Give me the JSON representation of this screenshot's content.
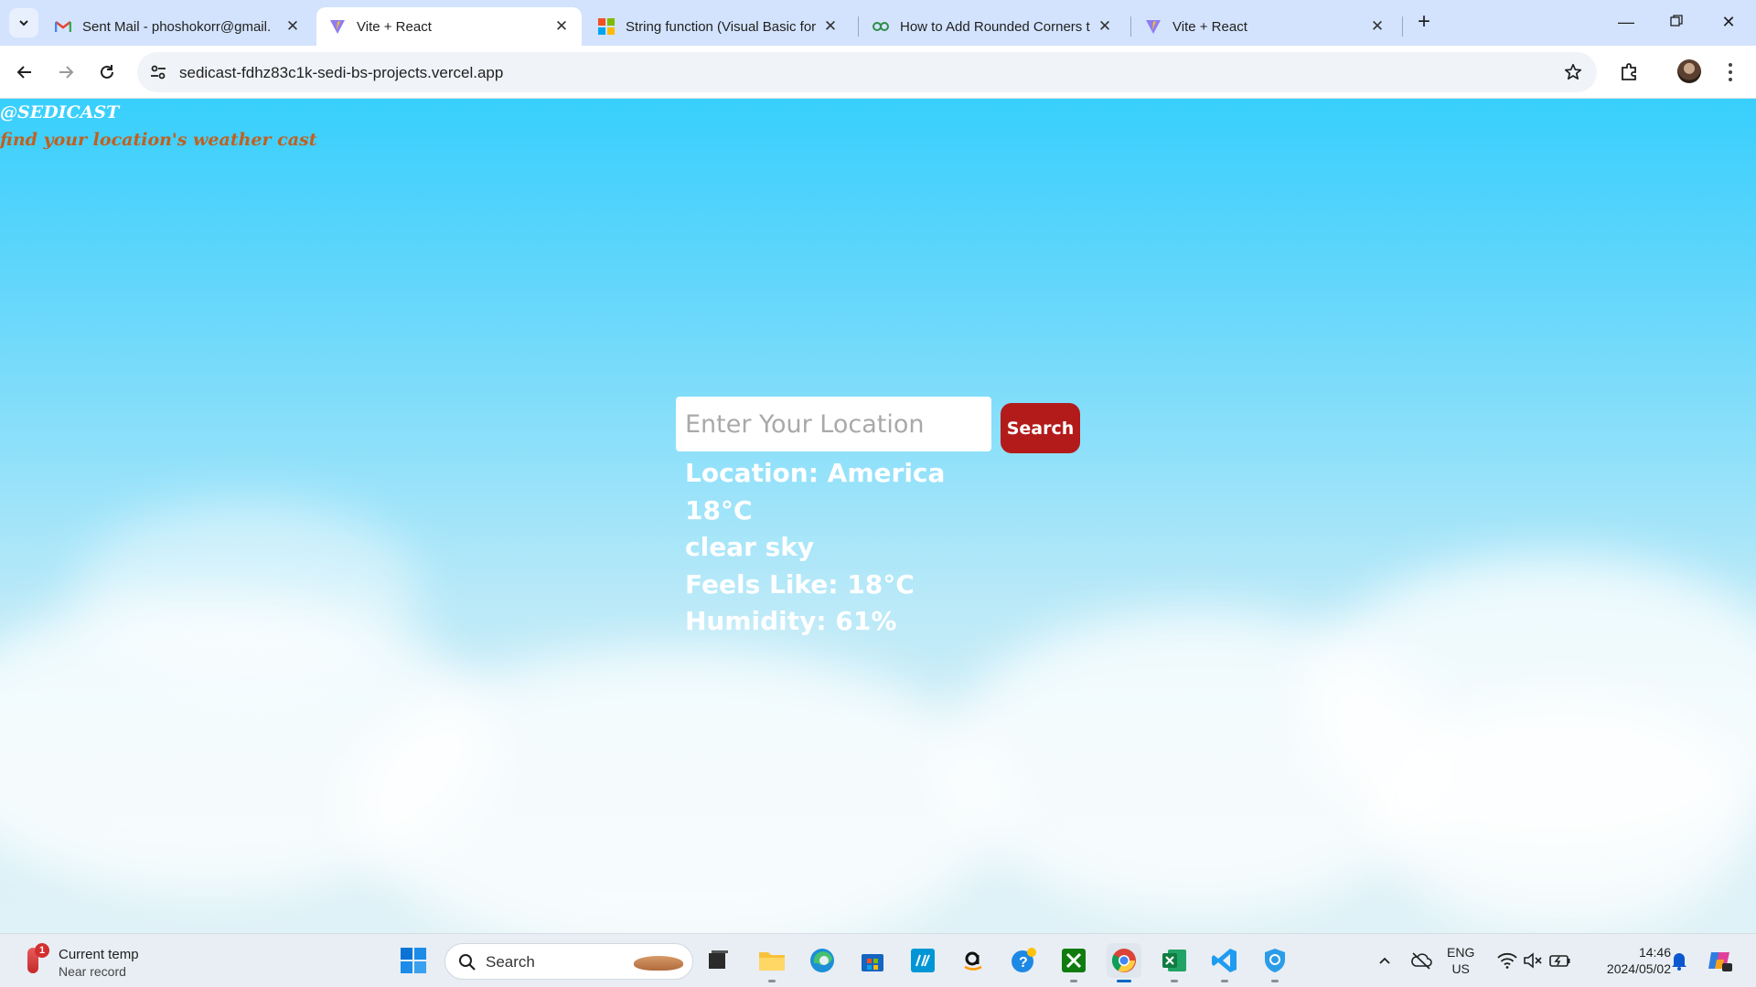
{
  "browser": {
    "tabs": [
      {
        "title": "Sent Mail - phoshokorr@gmail.",
        "icon": "gmail-icon"
      },
      {
        "title": "Vite + React",
        "icon": "vite-icon"
      },
      {
        "title": "String function (Visual Basic for",
        "icon": "microsoft-icon"
      },
      {
        "title": "How to Add Rounded Corners t",
        "icon": "geeksforgeeks-icon"
      },
      {
        "title": "Vite + React",
        "icon": "vite-icon"
      }
    ],
    "active_tab": 1,
    "url": "sedicast-fdhz83c1k-sedi-bs-projects.vercel.app"
  },
  "page": {
    "brand": "@SEDICAST",
    "tagline": "find your location's weather cast",
    "search_placeholder": "Enter Your Location",
    "search_button": "Search",
    "location": "Location: America",
    "temperature": "18°C",
    "description": "clear sky",
    "feels_like": "Feels Like: 18°C",
    "humidity": "Humidity: 61%"
  },
  "taskbar": {
    "weather_widget": {
      "badge": "1",
      "line1": "Current temp",
      "line2": "Near record"
    },
    "search_label": "Search",
    "language": {
      "line1": "ENG",
      "line2": "US"
    },
    "time": "14:46",
    "date": "2024/05/02"
  },
  "colors": {
    "accent_button": "#b31b1b",
    "tagline": "#c0601f",
    "sky_top": "#38cffc"
  }
}
